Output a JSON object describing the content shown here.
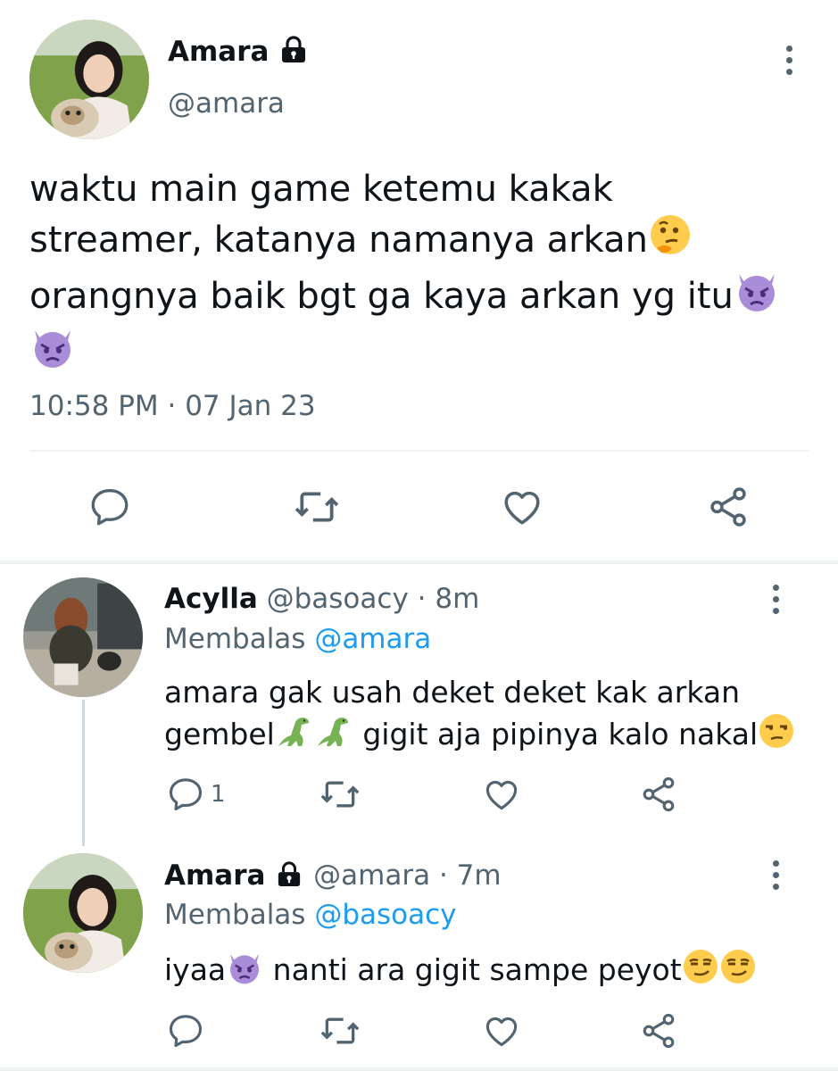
{
  "main_tweet": {
    "name": "Amara",
    "handle": "@amara",
    "text_line1": "waktu main game ketemu kakak",
    "text_line2": "streamer, katanya namanya arkan",
    "text_line3": "orangnya baik bgt ga kaya arkan yg itu",
    "timestamp": "10:58 PM · 07 Jan 23"
  },
  "replies": [
    {
      "name": "Acylla",
      "handle": "@basoacy",
      "time": "· 8m",
      "replying_to_label": "Membalas",
      "replying_to": "@amara",
      "text_line1": "amara gak usah deket deket kak arkan",
      "text_line2_a": "gembel",
      "text_line2_b": "gigit aja pipinya kalo nakal",
      "reply_count": "1"
    },
    {
      "name": "Amara",
      "handle": "@amara",
      "time": "· 7m",
      "replying_to_label": "Membalas",
      "replying_to": "@basoacy",
      "text_a": "iyaa",
      "text_b": "nanti ara gigit sampe peyot"
    }
  ],
  "icons": {
    "reply": "reply-icon",
    "retweet": "retweet-icon",
    "like": "heart-icon",
    "share": "share-icon",
    "more": "more-vertical-icon",
    "lock": "lock-icon"
  },
  "colors": {
    "accent": "#1d9bf0",
    "secondary_text": "#536471",
    "divider": "#eff3f4"
  }
}
